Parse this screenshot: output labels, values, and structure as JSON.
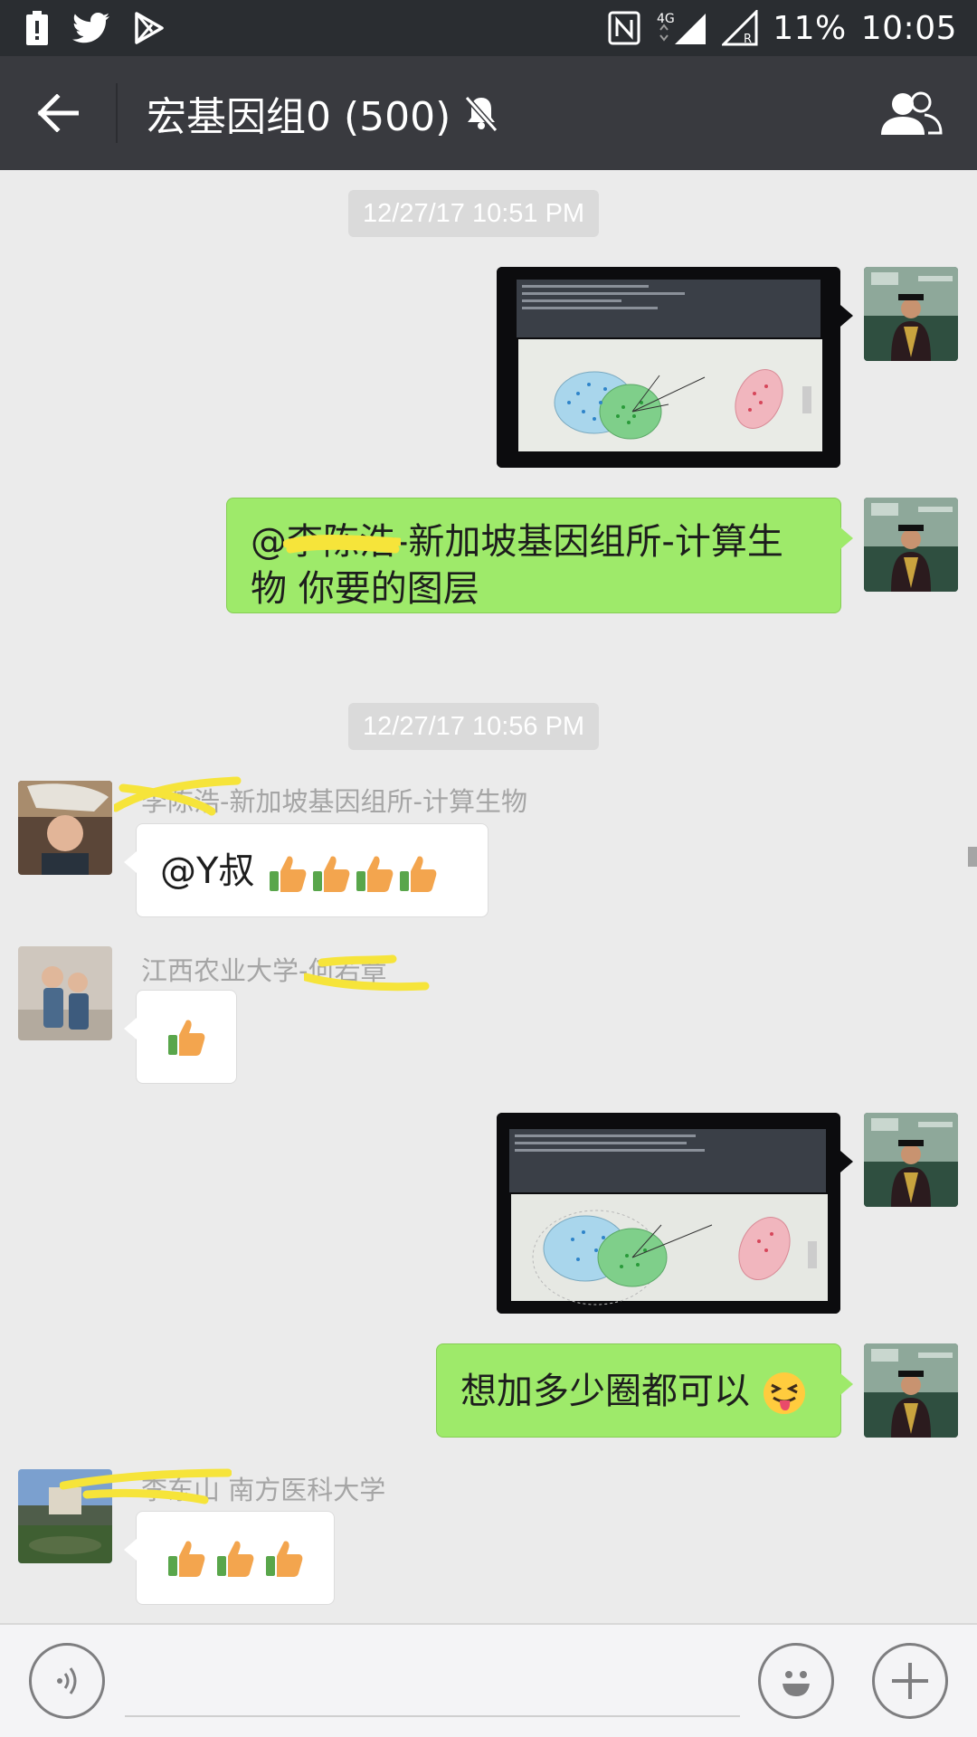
{
  "status_bar": {
    "battery": "11%",
    "time": "10:05",
    "network": "4G",
    "icons": [
      "battery-alert-icon",
      "twitter-icon",
      "play-store-icon",
      "nfc-icon",
      "signal-4g-icon",
      "signal-roaming-icon"
    ]
  },
  "header": {
    "title": "宏基因组0 (500)",
    "back_icon": "back-arrow-icon",
    "mute_icon": "bell-off-icon",
    "members_icon": "group-icon"
  },
  "messages": [
    {
      "type": "timestamp",
      "text": "12/27/17 10:51 PM"
    },
    {
      "type": "image",
      "side": "right",
      "content": "photo of a laptop screen showing a scatter plot with ellipses"
    },
    {
      "type": "text",
      "side": "right",
      "text_prefix": "@",
      "text_redacted": "李陈浩",
      "text_body": "-新加坡基因组所-计算生物 你要的图层"
    },
    {
      "type": "timestamp",
      "text": "12/27/17 10:56 PM"
    },
    {
      "type": "text",
      "side": "left",
      "sender_visible": "-新加坡基因组所-计算生物",
      "sender_redacted": "李陈浩",
      "text": "@Y叔",
      "emoji": [
        "thumbs-up",
        "thumbs-up",
        "thumbs-up",
        "thumbs-up"
      ]
    },
    {
      "type": "emoji",
      "side": "left",
      "sender_visible": "江西农业大学-",
      "sender_redacted": "何若章",
      "emoji": [
        "thumbs-up"
      ]
    },
    {
      "type": "image",
      "side": "right",
      "content": "photo of a laptop screen showing a scatter plot with ellipses"
    },
    {
      "type": "text",
      "side": "right",
      "text": "想加多少圈都可以",
      "emoji": [
        "tongue-out-wink"
      ]
    },
    {
      "type": "emoji",
      "side": "left",
      "sender_visible": "南方医科大学",
      "sender_redacted": "李东山",
      "emoji": [
        "thumbs-up",
        "thumbs-up",
        "thumbs-up"
      ]
    }
  ],
  "input_bar": {
    "placeholder": "",
    "voice_icon": "voice-icon",
    "emoji_icon": "smiley-icon",
    "plus_icon": "plus-icon"
  },
  "colors": {
    "status_bar_bg": "#2a2d31",
    "title_bar_bg": "#393a3f",
    "chat_bg": "#ebebeb",
    "bubble_sent": "#9eea6a",
    "bubble_received": "#ffffff",
    "timestamp_bg": "#dadada",
    "redaction_marker": "#f6e43a"
  }
}
